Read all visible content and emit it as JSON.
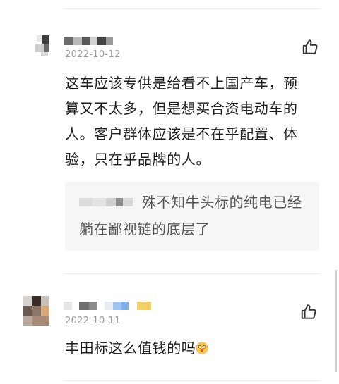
{
  "comments": [
    {
      "date": "2022-10-12",
      "text": "这车应该专供是给看不上国产车，预算又不太多，但是想买合资电动车的人。客户群体应该是不在乎配置、体验，只在乎品牌的人。",
      "reply": {
        "text": "殊不知牛头标的纯电已经躺在鄙视链的底层了"
      },
      "icons": {
        "like": "thumbs-up-icon"
      }
    },
    {
      "date": "2022-10-11",
      "text": "丰田标这么值钱的吗",
      "emoji": "astonished-face-emoji",
      "icons": {
        "like": "thumbs-up-icon"
      }
    }
  ],
  "colors": {
    "text": "#1f1f1f",
    "secondary": "#9b9b9b",
    "reply_bg": "#f6f6f6",
    "reply_text": "#555555",
    "divider": "#ececec"
  }
}
